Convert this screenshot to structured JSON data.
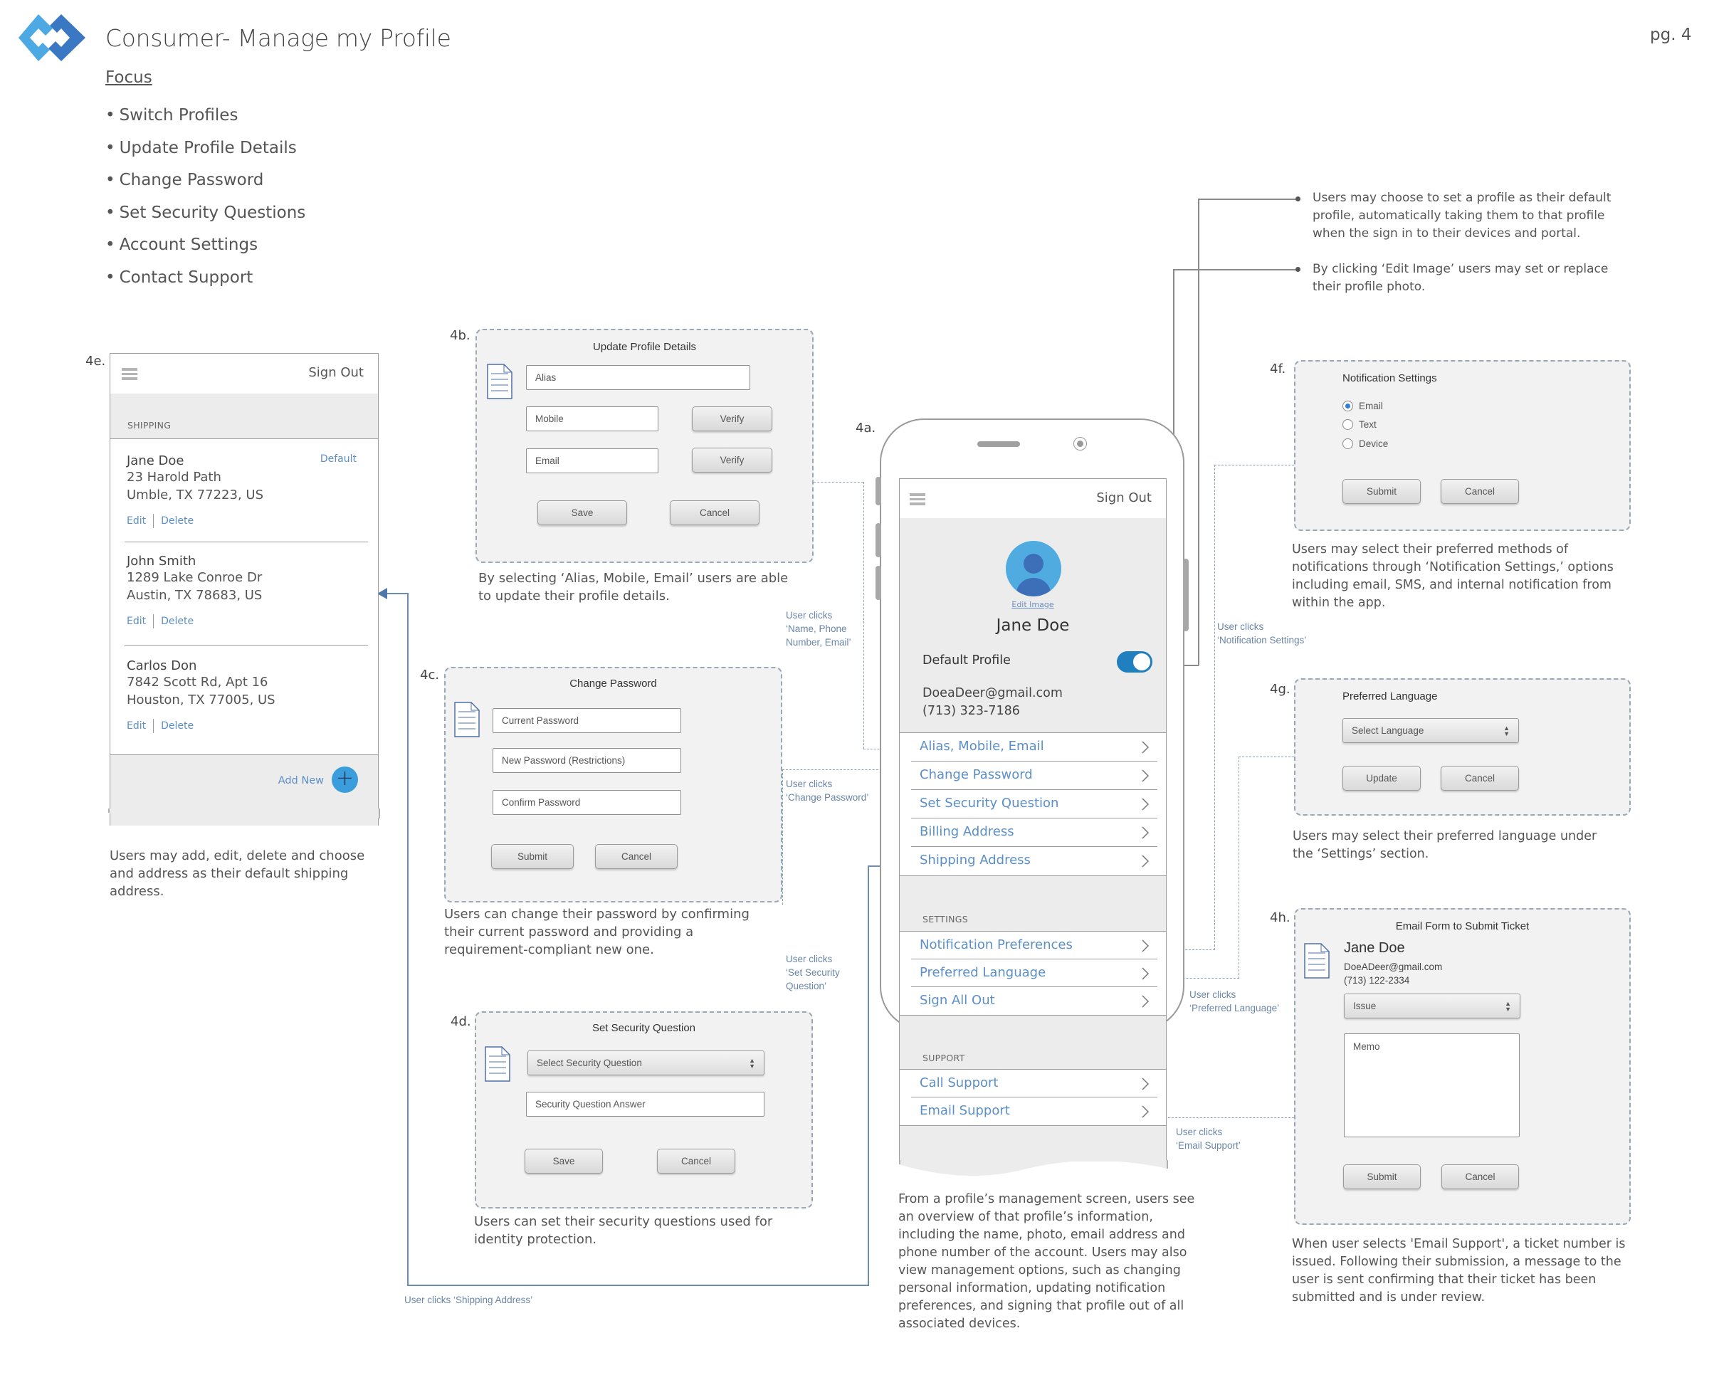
{
  "header": {
    "title": "Consumer- Manage my Profile",
    "page": "pg. 4",
    "focus_heading": "Focus",
    "focus_items": [
      "Switch Profiles",
      "Update Profile Details",
      "Change Password",
      "Set Security Questions",
      "Account Settings",
      "Contact Support"
    ]
  },
  "colors": {
    "accent": "#5b8fc6",
    "toggle": "#1f7fbf",
    "avatar": "#4fabe0",
    "dialog_bg": "#f3f2f3",
    "band": "#ececec"
  },
  "callouts": {
    "default_profile": "Users may choose to set a profile as their default profile, automatically taking them to that profile when the sign in to their devices and portal.",
    "edit_image": "By clicking ‘Edit Image’ users may set or replace their profile photo."
  },
  "notes": {
    "name_phone_email": [
      "User clicks",
      "‘Name, Phone",
      "Number, Email’"
    ],
    "change_password": [
      "User clicks",
      "‘Change Password’"
    ],
    "set_security": [
      "User clicks",
      "‘Set Security",
      "Question’"
    ],
    "shipping": "User clicks ‘Shipping Address’",
    "notification": [
      "User clicks",
      "‘Notification Settings’"
    ],
    "language": [
      "User clicks",
      "‘Preferred Language’"
    ],
    "email_support": [
      "User clicks",
      "‘Email Support’"
    ]
  },
  "s4a": {
    "step": "4a.",
    "sign_out": "Sign Out",
    "edit_image": "Edit Image",
    "name": "Jane Doe",
    "default_profile_label": "Default Profile",
    "default_profile_on": true,
    "email": "DoeaDeer@gmail.com",
    "phone": "(713) 323-7186",
    "profile_items": [
      "Alias, Mobile, Email",
      "Change Password",
      "Set Security Question",
      "Billing Address",
      "Shipping Address"
    ],
    "settings_label": "SETTINGS",
    "settings_items": [
      "Notification Preferences",
      "Preferred Language",
      "Sign All Out"
    ],
    "support_label": "SUPPORT",
    "support_items": [
      "Call Support",
      "Email Support"
    ],
    "description": "From a profile’s management screen, users see an overview of that profile’s information, including the name, photo, email address and phone number of the account. Users may also view management options, such as changing personal information, updating notification preferences, and signing that profile out of all associated devices."
  },
  "s4b": {
    "step": "4b.",
    "title": "Update Profile Details",
    "alias": "Alias",
    "mobile": "Mobile",
    "email": "Email",
    "verify": "Verify",
    "save": "Save",
    "cancel": "Cancel",
    "description": "By selecting ‘Alias, Mobile, Email’ users are able to update their profile details."
  },
  "s4c": {
    "step": "4c.",
    "title": "Change Password",
    "current": "Current Password",
    "new": "New Password (Restrictions)",
    "confirm": "Confirm Password",
    "submit": "Submit",
    "cancel": "Cancel",
    "description": "Users can change their password by confirming their current password and providing a requirement-compliant new one."
  },
  "s4d": {
    "step": "4d.",
    "title": "Set Security Question",
    "select": "Select Security Question",
    "answer": "Security Question Answer",
    "save": "Save",
    "cancel": "Cancel",
    "description": "Users can set their security questions used for identity protection."
  },
  "s4e": {
    "step": "4e.",
    "sign_out": "Sign Out",
    "section": "SHIPPING",
    "default_label": "Default",
    "addresses": [
      {
        "name": "Jane Doe",
        "line1": "23 Harold Path",
        "line2": "Umble, TX 77223, US",
        "is_default": true
      },
      {
        "name": "John Smith",
        "line1": "1289 Lake Conroe Dr",
        "line2": "Austin, TX 78683, US",
        "is_default": false
      },
      {
        "name": "Carlos Don",
        "line1": "7842 Scott Rd, Apt 16",
        "line2": "Houston, TX 77005, US",
        "is_default": false
      }
    ],
    "edit": "Edit",
    "delete": "Delete",
    "add_new": "Add New",
    "description": "Users may add, edit, delete and choose and address as their default shipping address."
  },
  "s4f": {
    "step": "4f.",
    "title": "Notification Settings",
    "options": [
      "Email",
      "Text",
      "Device"
    ],
    "selected": "Email",
    "submit": "Submit",
    "cancel": "Cancel",
    "description": "Users may select their preferred methods of notifications through ‘Notification Settings,’ options including email, SMS, and internal notification from within the app."
  },
  "s4g": {
    "step": "4g.",
    "title": "Preferred Language",
    "select": "Select Language",
    "update": "Update",
    "cancel": "Cancel",
    "description": "Users may select their preferred language under the ‘Settings’ section."
  },
  "s4h": {
    "step": "4h.",
    "title": "Email Form to Submit Ticket",
    "name": "Jane Doe",
    "email": "DoeADeer@gmail.com",
    "phone": "(713) 122-2334",
    "issue": "Issue",
    "memo": "Memo",
    "submit": "Submit",
    "cancel": "Cancel",
    "description": "When user selects 'Email Support', a ticket number is issued. Following their submission, a message to the user is sent confirming that their ticket has been submitted and is under review."
  }
}
